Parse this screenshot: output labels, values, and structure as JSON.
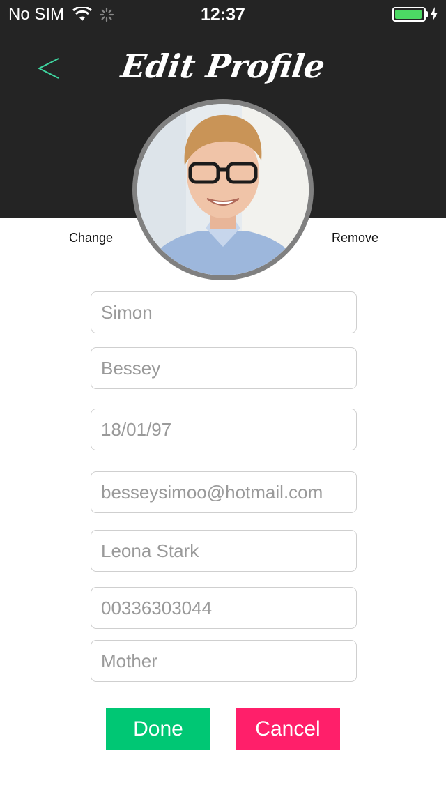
{
  "status_bar": {
    "carrier": "No SIM",
    "time": "12:37",
    "battery_level": 0.95
  },
  "header": {
    "title": "Edit Profile",
    "back_icon": "chevron-left-icon"
  },
  "photo": {
    "change_label": "Change",
    "remove_label": "Remove"
  },
  "form": {
    "first_name": "Simon",
    "last_name": "Bessey",
    "birth_date": "18/01/97",
    "email": "besseysimoo@hotmail.com",
    "contact_name": "Leona Stark",
    "contact_phone": "00336303044",
    "relationship": "Mother"
  },
  "actions": {
    "done_label": "Done",
    "cancel_label": "Cancel"
  },
  "colors": {
    "header_bg": "#242424",
    "accent_green": "#00c774",
    "accent_pink": "#ff1f6a",
    "back_arrow": "#3fd6a0"
  }
}
